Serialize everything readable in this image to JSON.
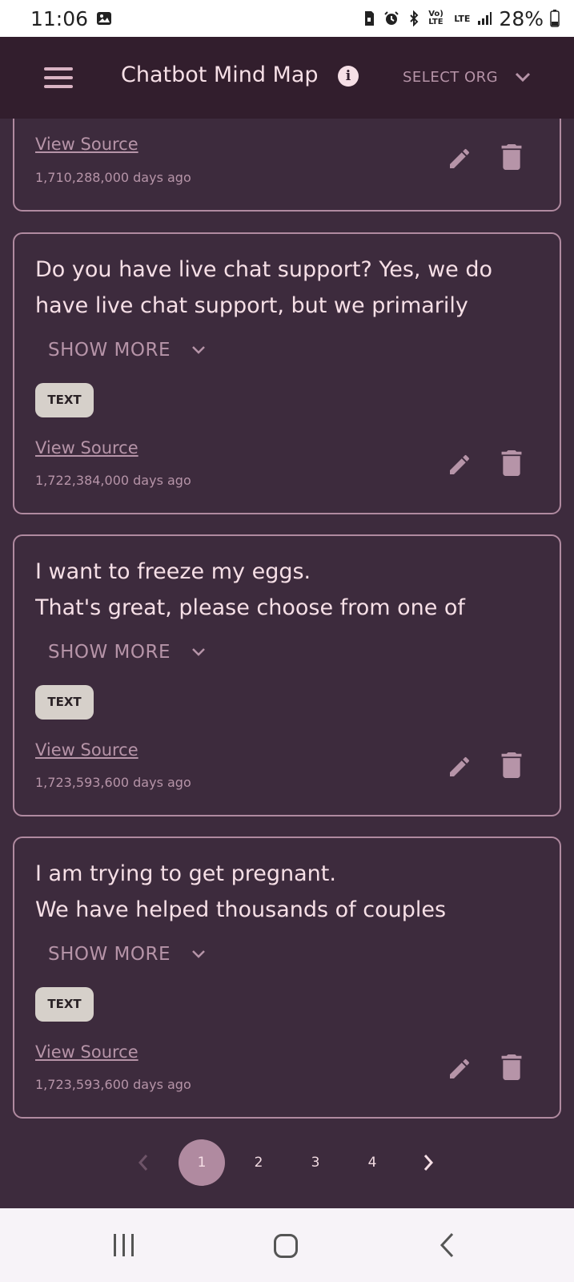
{
  "status_bar": {
    "time": "11:06",
    "network": "Vo) LTE",
    "lte": "LTE",
    "battery": "28%",
    "icons": [
      "gallery-icon",
      "sim-icon",
      "alarm-icon",
      "bluetooth-icon",
      "signal-icon",
      "battery-icon"
    ]
  },
  "app_bar": {
    "title": "Chatbot Mind Map",
    "select_org": "SELECT ORG",
    "colors": {
      "background": "#321e2d",
      "accent": "#b08aa0"
    }
  },
  "cards": [
    {
      "text": "",
      "show_more": "",
      "chip": "",
      "view_source": "View Source",
      "timestamp": "1,710,288,000 days ago"
    },
    {
      "text": "Do you have live chat support? Yes, we do have live chat support, but we primarily",
      "show_more": "SHOW MORE",
      "chip": "TEXT",
      "view_source": "View Source",
      "timestamp": "1,722,384,000 days ago"
    },
    {
      "text": "I want to freeze my eggs.\nThat's great, please choose from one of",
      "show_more": "SHOW MORE",
      "chip": "TEXT",
      "view_source": "View Source",
      "timestamp": "1,723,593,600 days ago"
    },
    {
      "text": "I am trying to get pregnant.\nWe have helped thousands of couples",
      "show_more": "SHOW MORE",
      "chip": "TEXT",
      "view_source": "View Source",
      "timestamp": "1,723,593,600 days ago"
    }
  ],
  "pagination": {
    "pages": [
      "1",
      "2",
      "3",
      "4"
    ],
    "current": "1"
  }
}
